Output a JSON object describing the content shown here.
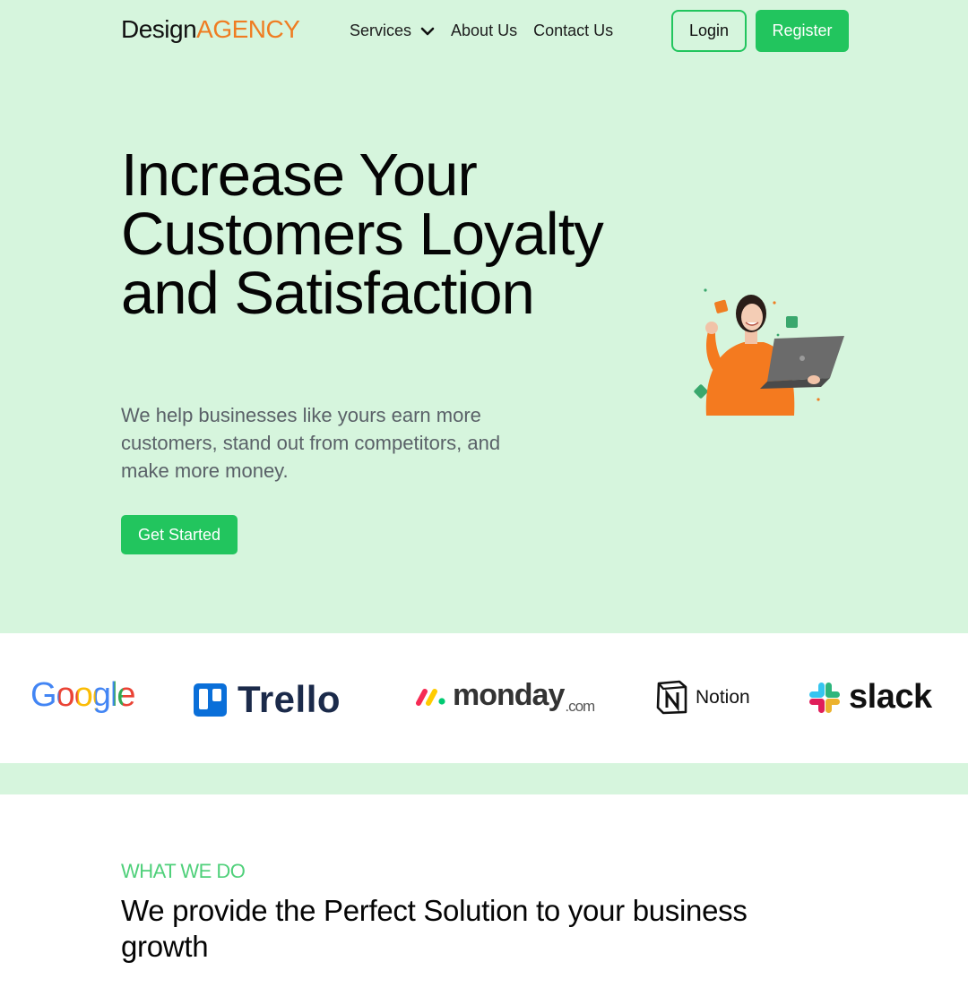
{
  "header": {
    "logo_part1": "Design",
    "logo_part2": "AGENCY",
    "nav": {
      "services": "Services",
      "about": "About Us",
      "contact": "Contact Us"
    },
    "login": "Login",
    "register": "Register"
  },
  "hero": {
    "title": "Increase Your Customers Loyalty and Satisfaction",
    "subtitle": "We help businesses like yours earn more customers, stand out from competitors, and make more money.",
    "cta": "Get Started"
  },
  "partners": {
    "google": "Google",
    "trello": "Trello",
    "monday": "monday",
    "monday_suffix": ".com",
    "notion": "Notion",
    "slack": "slack"
  },
  "section": {
    "eyebrow": "WHAT WE DO",
    "title": "We provide the Perfect Solution to your business growth"
  },
  "colors": {
    "accent": "#22c55e",
    "hero_background": "#d6f5dd",
    "logo_accent": "#ef7d22",
    "eyebrow": "#4fd07a"
  }
}
